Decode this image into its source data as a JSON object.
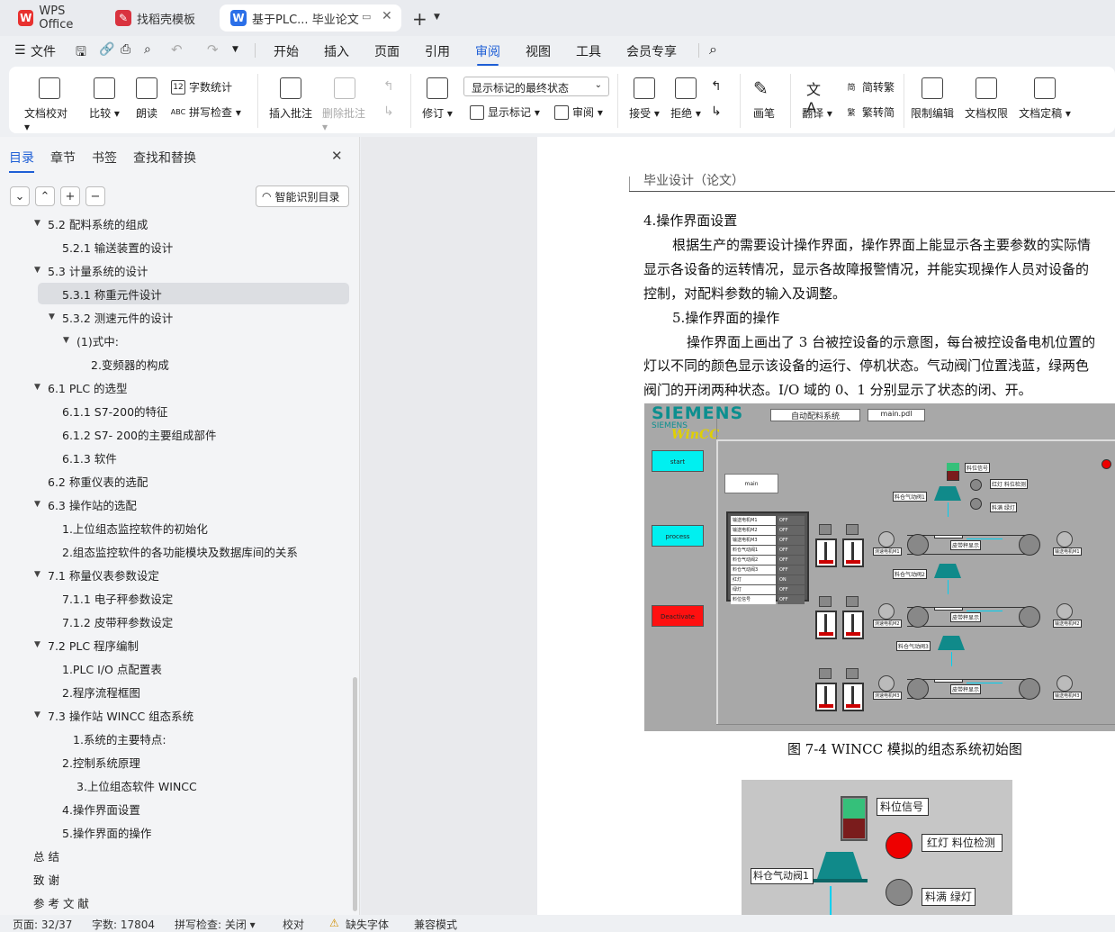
{
  "tabs": [
    {
      "label": "WPS Office",
      "active": false
    },
    {
      "label": "找稻壳模板",
      "active": false
    },
    {
      "label": "基于PLC... 毕业论文",
      "active": true
    }
  ],
  "menu": {
    "file": "文件",
    "items": [
      "开始",
      "插入",
      "页面",
      "引用",
      "审阅",
      "视图",
      "工具",
      "会员专享"
    ],
    "active": "审阅"
  },
  "ribbon": {
    "doc_proofread": "文档校对",
    "compare": "比较",
    "read_aloud": "朗读",
    "word_count": "字数统计",
    "spell_check": "拼写检查",
    "insert_comment": "插入批注",
    "delete_comment": "删除批注",
    "revise": "修订",
    "markup_select": "显示标记的最终状态",
    "show_markup": "显示标记",
    "review": "审阅",
    "accept": "接受",
    "reject": "拒绝",
    "pen": "画笔",
    "translate": "翻译",
    "to_traditional": "简转繁",
    "to_simplified": "繁转简",
    "restrict_edit": "限制编辑",
    "doc_permission": "文档权限",
    "doc_finalize": "文档定稿"
  },
  "panel": {
    "tabs": [
      "目录",
      "章节",
      "书签",
      "查找和替换"
    ],
    "smart_toc": "智能识别目录",
    "toc": [
      {
        "text": "5.2  配料系统的组成",
        "level": 1,
        "caret": true
      },
      {
        "text": "5.2.1  输送装置的设计",
        "level": 2,
        "caret": false
      },
      {
        "text": "5.3  计量系统的设计",
        "level": 1,
        "caret": true
      },
      {
        "text": "5.3.1  称重元件设计",
        "level": 2,
        "caret": false,
        "selected": true
      },
      {
        "text": "5.3.2  测速元件的设计",
        "level": 2,
        "caret": true
      },
      {
        "text": "(1)式中:",
        "level": 3,
        "caret": true
      },
      {
        "text": "2.变频器的构成",
        "level": 4,
        "caret": false
      },
      {
        "text": "6.1 PLC 的选型",
        "level": 1,
        "caret": true
      },
      {
        "text": "6.1.1 S7-200的特征",
        "level": 2,
        "caret": false
      },
      {
        "text": "6.1.2 S7- 200的主要组成部件",
        "level": 2,
        "caret": false
      },
      {
        "text": "6.1.3  软件",
        "level": 2,
        "caret": false
      },
      {
        "text": "6.2  称重仪表的选配",
        "level": 1,
        "caret": false
      },
      {
        "text": "6.3  操作站的选配",
        "level": 1,
        "caret": true
      },
      {
        "text": "1.上位组态监控软件的初始化",
        "level": 2,
        "caret": false
      },
      {
        "text": "2.组态监控软件的各功能模块及数据库间的关系",
        "level": 2,
        "caret": false
      },
      {
        "text": "7.1  称量仪表参数设定",
        "level": 1,
        "caret": true
      },
      {
        "text": "7.1.1  电子秤参数设定",
        "level": 2,
        "caret": false
      },
      {
        "text": "7.1.2  皮带秤参数设定",
        "level": 2,
        "caret": false
      },
      {
        "text": "7.2 PLC 程序编制",
        "level": 1,
        "caret": true
      },
      {
        "text": "1.PLC I/O 点配置表",
        "level": 2,
        "caret": false
      },
      {
        "text": "2.程序流程框图",
        "level": 2,
        "caret": false
      },
      {
        "text": "7.3 操作站 WINCC 组态系统",
        "level": 1,
        "caret": true
      },
      {
        "text": "1.系统的主要特点:",
        "level": 3.5,
        "caret": false
      },
      {
        "text": "2.控制系统原理",
        "level": 2,
        "caret": false
      },
      {
        "text": "3.上位组态软件 WINCC",
        "level": 3,
        "caret": false
      },
      {
        "text": "4.操作界面设置",
        "level": 2,
        "caret": false
      },
      {
        "text": "5.操作界面的操作",
        "level": 2,
        "caret": false
      },
      {
        "text": "总   结",
        "level": 0,
        "caret": false
      },
      {
        "text": "致  谢",
        "level": 0,
        "caret": false
      },
      {
        "text": "参 考 文 献",
        "level": 0,
        "caret": false
      }
    ]
  },
  "doc": {
    "header": "毕业设计（论文）",
    "heading1": "4.操作界面设置",
    "para1": [
      "根据生产的需要设计操作界面，操作界面上能显示各主要参数的实际情",
      "显示各设备的运转情况，显示各故障报警情况，并能实现操作人员对设备的",
      "控制，对配料参数的输入及调整。"
    ],
    "heading2": "5.操作界面的操作",
    "para2": [
      "操作界面上画出了 3 台被控设备的示意图，每台被控设备电机位置的",
      "灯以不同的颜色显示该设备的运行、停机状态。气动阀门位置浅蓝，绿两色",
      "阀门的开闭两种状态。I/O 域的 0、1 分别显示了状态的闭、开。"
    ],
    "figure_caption": "图 7-4 WINCC 模拟的组态系统初始图",
    "wincc": {
      "brand": "SIEMENS",
      "product": "WinCC",
      "title_box": "自动配料系统",
      "file_box": "main.pdl",
      "btn_start": "start",
      "btn_process": "process",
      "btn_deactivate": "Deactivate",
      "btn_main": "main",
      "status_rows": [
        [
          "输送电机M1",
          "OFF"
        ],
        [
          "输送电机M2",
          "OFF"
        ],
        [
          "输送电机M3",
          "OFF"
        ],
        [
          "料仓气动阀1",
          "OFF"
        ],
        [
          "料仓气动阀2",
          "OFF"
        ],
        [
          "料仓气动阀3",
          "OFF"
        ],
        [
          "红灯",
          "ON"
        ],
        [
          "绿灯",
          "OFF"
        ],
        [
          "料位信号",
          "OFF"
        ]
      ],
      "lbl_level_signal": "料位信号",
      "lbl_red_light": "红灯 料位检测",
      "lbl_full_green": "料满 绿灯",
      "lbl_valve1": "料仓气动阀1",
      "lbl_valve2": "料仓气动阀2",
      "lbl_valve3": "料仓气动阀3",
      "lbl_belt_display": "皮带秤显示",
      "lbl_speed1": "测速电机M1",
      "lbl_speed2": "测速电机M2",
      "lbl_speed3": "测速电机M3",
      "lbl_drive1": "输送电机M1",
      "lbl_drive2": "输送电机M2",
      "lbl_drive3": "输送电机M3"
    },
    "zoom_fig": {
      "level_signal": "料位信号",
      "red_detect": "红灯 料位检测",
      "valve1": "料仓气动阀1",
      "full_green": "料满 绿灯"
    }
  },
  "status": {
    "page": "页面: 32/37",
    "words": "字数: 17804",
    "spell": "拼写检查: 关闭",
    "proof": "校对",
    "missing_font": "缺失字体",
    "compat": "兼容模式"
  }
}
